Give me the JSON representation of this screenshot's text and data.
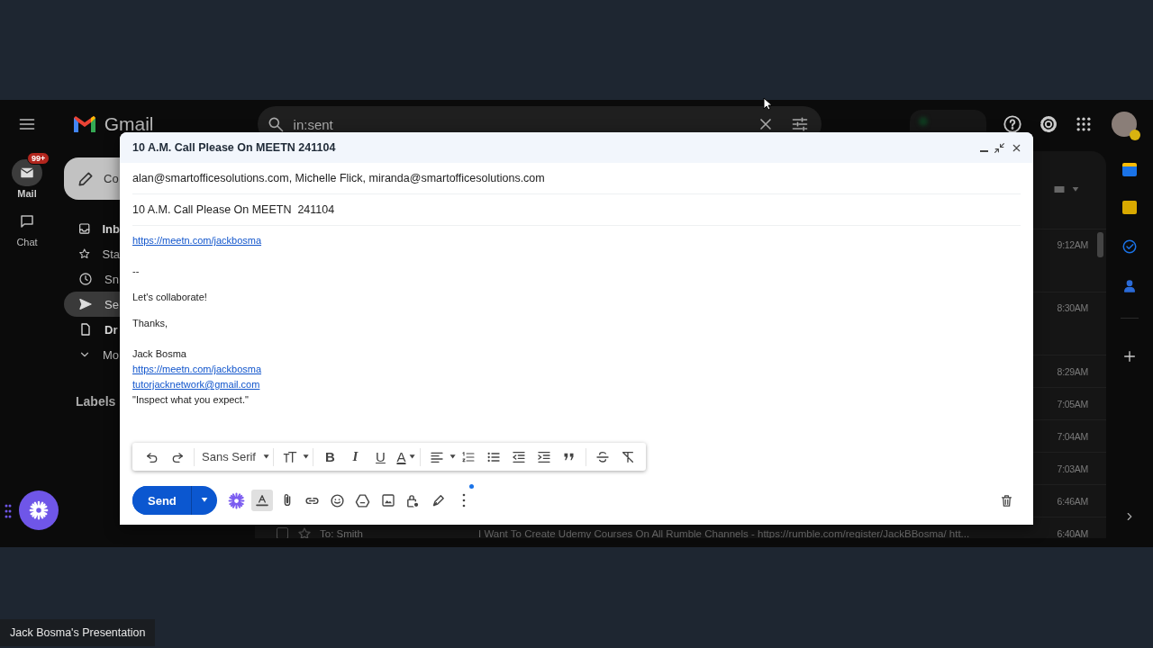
{
  "meeting": {
    "presenter_label": "Jack Bosma's Presentation"
  },
  "gmail": {
    "app_name": "Gmail",
    "search": {
      "value": "in:sent"
    },
    "rail": [
      {
        "label": "Mail",
        "badge": "99+",
        "selected": true
      },
      {
        "label": "Chat",
        "selected": false
      }
    ],
    "compose_button": {
      "label": "Co"
    },
    "nav": [
      {
        "label": "Inb",
        "unread": true,
        "selected": false
      },
      {
        "label": "Sta",
        "unread": false,
        "selected": false
      },
      {
        "label": "Sn",
        "unread": false,
        "selected": false
      },
      {
        "label": "Se",
        "unread": false,
        "selected": true
      },
      {
        "label": "Dr",
        "unread": true,
        "selected": false
      },
      {
        "label": "Mo",
        "unread": false,
        "selected": false
      }
    ],
    "labels_heading": "Labels",
    "rows": [
      {
        "time": "9:12AM"
      },
      {
        "time": "8:30AM"
      },
      {
        "time": "8:29AM"
      },
      {
        "time": "7:05AM"
      },
      {
        "time": "7:04AM"
      },
      {
        "time": "7:03AM"
      },
      {
        "time": "6:46AM"
      },
      {
        "recipient": "To: Smith",
        "checked": false,
        "subject": "I Want To Create Udemy Courses On All Rumble Channels - https://rumble.com/register/JackBBosma/ htt...",
        "time": "6:40AM"
      }
    ]
  },
  "compose": {
    "title": "10 A.M. Call Please On MEETN 241104",
    "recipients": "alan@smartofficesolutions.com, Michelle Flick, miranda@smartofficesolutions.com",
    "subject": "10 A.M. Call Please On MEETN  241104",
    "body": [
      {
        "lines": [
          {
            "kind": "link",
            "text": "https://meetn.com/jackbosma"
          }
        ]
      },
      {
        "lines": [
          {
            "kind": "text",
            "text": "--"
          }
        ]
      },
      {
        "lines": [
          {
            "kind": "text",
            "text": "Let's collaborate!"
          }
        ]
      },
      {
        "lines": [
          {
            "kind": "text",
            "text": "Thanks,"
          }
        ]
      },
      {
        "lines": [
          {
            "kind": "text",
            "text": "Jack Bosma"
          },
          {
            "kind": "link",
            "text": "https://meetn.com/jackbosma"
          },
          {
            "kind": "link",
            "text": "tutorjacknetwork@gmail.com"
          },
          {
            "kind": "text",
            "text": "\"Inspect what you expect.\""
          }
        ]
      }
    ],
    "formatting_open": true,
    "font": "Sans Serif",
    "format_glyphs": [
      "B",
      "I",
      "U"
    ],
    "text_color_glyph": "A",
    "send_label": "Send",
    "more_options_dot": true
  }
}
